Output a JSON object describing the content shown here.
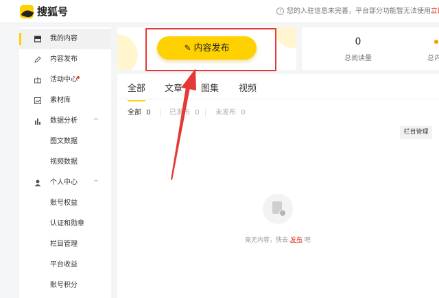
{
  "header": {
    "logo_text": "搜狐号",
    "notice_text": "您的入驻信息未完善，平台部分功能暂无法使用。",
    "notice_link": "立即"
  },
  "sidebar": {
    "items": [
      {
        "label": "我的内容",
        "icon": "inbox-icon"
      },
      {
        "label": "内容发布",
        "icon": "pencil-icon"
      },
      {
        "label": "活动中心",
        "icon": "gift-icon"
      },
      {
        "label": "素材库",
        "icon": "image-icon"
      },
      {
        "label": "数据分析",
        "icon": "bar-chart-icon"
      },
      {
        "label": "图文数据"
      },
      {
        "label": "视频数据"
      },
      {
        "label": "个人中心",
        "icon": "user-icon"
      },
      {
        "label": "账号权益"
      },
      {
        "label": "认证和勋章"
      },
      {
        "label": "栏目管理"
      },
      {
        "label": "平台收益"
      },
      {
        "label": "账号积分"
      }
    ],
    "chevron": "^"
  },
  "publish": {
    "button_label": "内容发布"
  },
  "stats": {
    "total_reads_value": "0",
    "total_reads_label": "总阅读量",
    "second_label": "总内"
  },
  "main": {
    "tabs": [
      "全部",
      "文章",
      "图集",
      "视频"
    ],
    "filters": {
      "all_label": "全部",
      "all_count": "0",
      "published_label": "已发布",
      "published_count": "0",
      "unpublished_label": "未发布",
      "unpublished_count": "0"
    },
    "column_manage_button": "栏目管理",
    "empty": {
      "prefix": "竟无内容，快去",
      "link": "发布",
      "suffix": "吧"
    }
  },
  "colors": {
    "accent": "#ffd100",
    "highlight": "#e53935",
    "link": "#e0402b"
  }
}
